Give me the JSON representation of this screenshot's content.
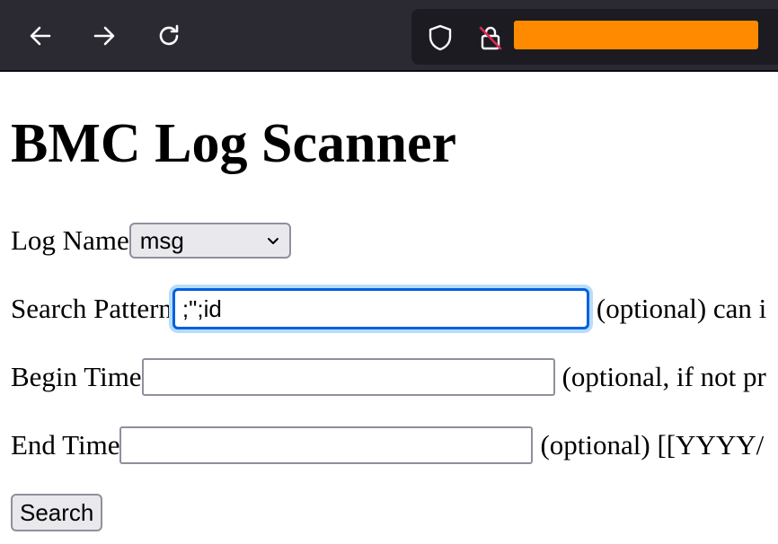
{
  "browser": {
    "toolbar_icon_color": "#fbfbfe",
    "url_redaction_color": "#ff8a00",
    "tracking_lock_slash_color": "#e22850"
  },
  "page": {
    "title": "BMC Log Scanner"
  },
  "form": {
    "log_name": {
      "label": "Log Name",
      "selected": "msg"
    },
    "search_pattern": {
      "label": "Search Pattern",
      "value": ";\";id",
      "hint": "(optional) can i"
    },
    "begin_time": {
      "label": "Begin Time",
      "value": "",
      "hint": "(optional, if not pr"
    },
    "end_time": {
      "label": "End Time",
      "value": "",
      "hint": "(optional) [[YYYY/"
    },
    "submit_label": "Search"
  }
}
